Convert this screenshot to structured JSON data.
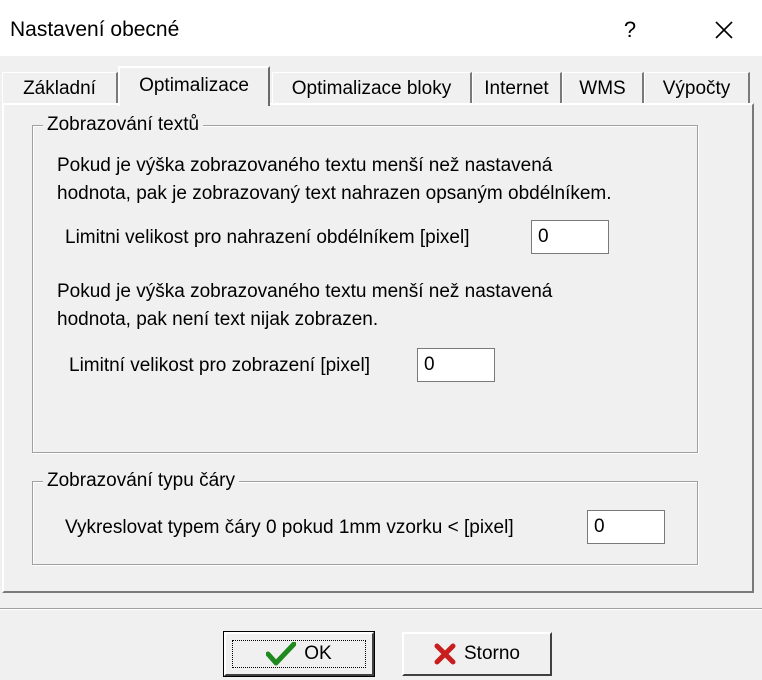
{
  "window": {
    "title": "Nastavení obecné",
    "help_label": "?",
    "close_label": "✕"
  },
  "tabs": [
    {
      "label": "Základní",
      "active": false
    },
    {
      "label": "Optimalizace",
      "active": true
    },
    {
      "label": "Optimalizace bloky",
      "active": false
    },
    {
      "label": "Internet",
      "active": false
    },
    {
      "label": "WMS",
      "active": false
    },
    {
      "label": "Výpočty",
      "active": false
    }
  ],
  "text_group": {
    "legend": "Zobrazování textů",
    "desc1_line1": "Pokud je výška zobrazovaného textu menší než nastavená",
    "desc1_line2": "hodnota, pak je zobrazovaný text nahrazen opsaným obdélníkem.",
    "limit_rect_label": "Limitni velikost pro nahrazení obdélníkem [pixel]",
    "limit_rect_value": "0",
    "desc2_line1": "Pokud je výška zobrazovaného textu menší než nastavená",
    "desc2_line2": "hodnota, pak není text nijak zobrazen.",
    "limit_show_label": "Limitní velikost pro zobrazení [pixel]",
    "limit_show_value": "0"
  },
  "line_group": {
    "legend": "Zobrazování typu čáry",
    "draw_label": "Vykreslovat typem čáry 0 pokud 1mm vzorku < [pixel]",
    "draw_value": "0"
  },
  "buttons": {
    "ok_label": "OK",
    "cancel_label": "Storno"
  },
  "colors": {
    "ok_check": "#1e8a1e",
    "cancel_x": "#c81e1e"
  }
}
